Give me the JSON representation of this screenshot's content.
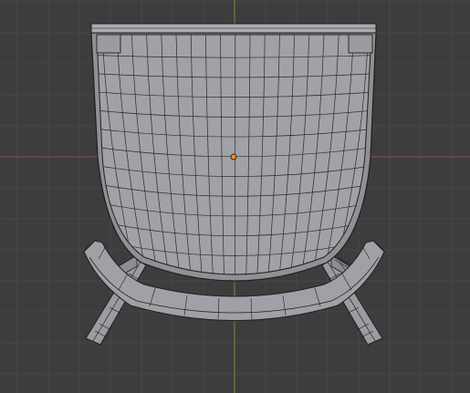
{
  "viewport": {
    "view_label": "",
    "colors": {
      "background": "#3d3d3d",
      "grid_minor": "#444444",
      "grid_major": "#393939",
      "axis_x": "#9c4b50",
      "axis_y": "#6e8e3e",
      "mesh_fill": "#9fa1a6",
      "mesh_fill_dark": "#8f9196",
      "wire": "#1f1f1f",
      "origin": "#f08a24"
    }
  },
  "object": {
    "name": "chair mesh",
    "icon": "mesh-object-icon"
  }
}
